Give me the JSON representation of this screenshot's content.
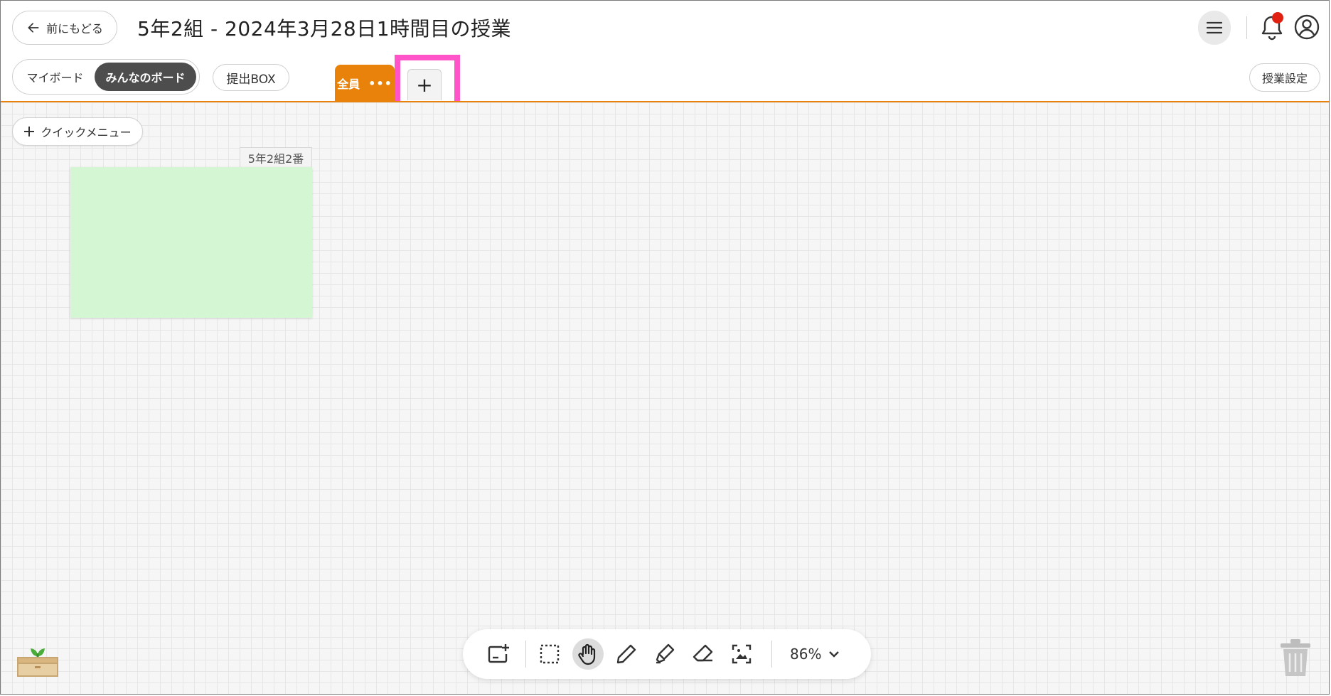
{
  "header": {
    "back_label": "前にもどる",
    "title": "5年2組 - 2024年3月28日1時間目の授業"
  },
  "board_switch": {
    "my_board": "マイボード",
    "everyone_board": "みんなのボード"
  },
  "submit_box_label": "提出BOX",
  "tabs": [
    {
      "label": "全員",
      "more": "•••"
    }
  ],
  "add_tab_label": "+",
  "lesson_settings_label": "授業設定",
  "quick_menu_label": "クイックメニュー",
  "cards": [
    {
      "owner_label": "5年2組2番",
      "color": "#d4f6d2"
    }
  ],
  "toolbar": {
    "tools": [
      "add-card-icon",
      "select-icon",
      "hand-icon",
      "pen-icon",
      "marker-icon",
      "eraser-icon",
      "capture-icon"
    ],
    "active_tool": "hand-icon",
    "zoom_label": "86%"
  },
  "colors": {
    "accent": "#e8820a",
    "highlight": "#ff55c8",
    "notification": "#e02010",
    "card": "#d4f6d2"
  }
}
